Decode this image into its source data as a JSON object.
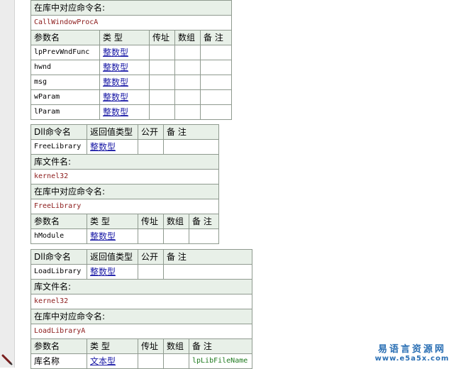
{
  "callwindowproc": {
    "lib_cmd_label": "在库中对应命令名:",
    "lib_cmd_value": "CallWindowProcA",
    "headers": [
      "参数名",
      "类 型",
      "传址",
      "数组",
      "备 注"
    ],
    "params": [
      {
        "name": "lpPrevWndFunc",
        "type": "整数型"
      },
      {
        "name": "hwnd",
        "type": "整数型"
      },
      {
        "name": "msg",
        "type": "整数型"
      },
      {
        "name": "wParam",
        "type": "整数型"
      },
      {
        "name": "lParam",
        "type": "整数型"
      }
    ]
  },
  "freelibrary": {
    "dll_headers": [
      "Dll命令名",
      "返回值类型",
      "公开",
      "备 注"
    ],
    "dll_name": "FreeLibrary",
    "return_type": "整数型",
    "lib_file_label": "库文件名:",
    "lib_file_value": "kernel32",
    "lib_cmd_label": "在库中对应命令名:",
    "lib_cmd_value": "FreeLibrary",
    "headers": [
      "参数名",
      "类 型",
      "传址",
      "数组",
      "备 注"
    ],
    "params": [
      {
        "name": "hModule",
        "type": "整数型"
      }
    ]
  },
  "loadlibrary": {
    "dll_headers": [
      "Dll命令名",
      "返回值类型",
      "公开",
      "备 注"
    ],
    "dll_name": "LoadLibrary",
    "return_type": "整数型",
    "lib_file_label": "库文件名:",
    "lib_file_value": "kernel32",
    "lib_cmd_label": "在库中对应命令名:",
    "lib_cmd_value": "LoadLibraryA",
    "headers": [
      "参数名",
      "类 型",
      "传址",
      "数组",
      "备 注"
    ],
    "params": [
      {
        "name": "库名称",
        "type": "文本型",
        "note": "lpLibFileName"
      }
    ]
  },
  "watermark": {
    "name": "易语言资源网",
    "url": "www.e5a5x.com"
  }
}
